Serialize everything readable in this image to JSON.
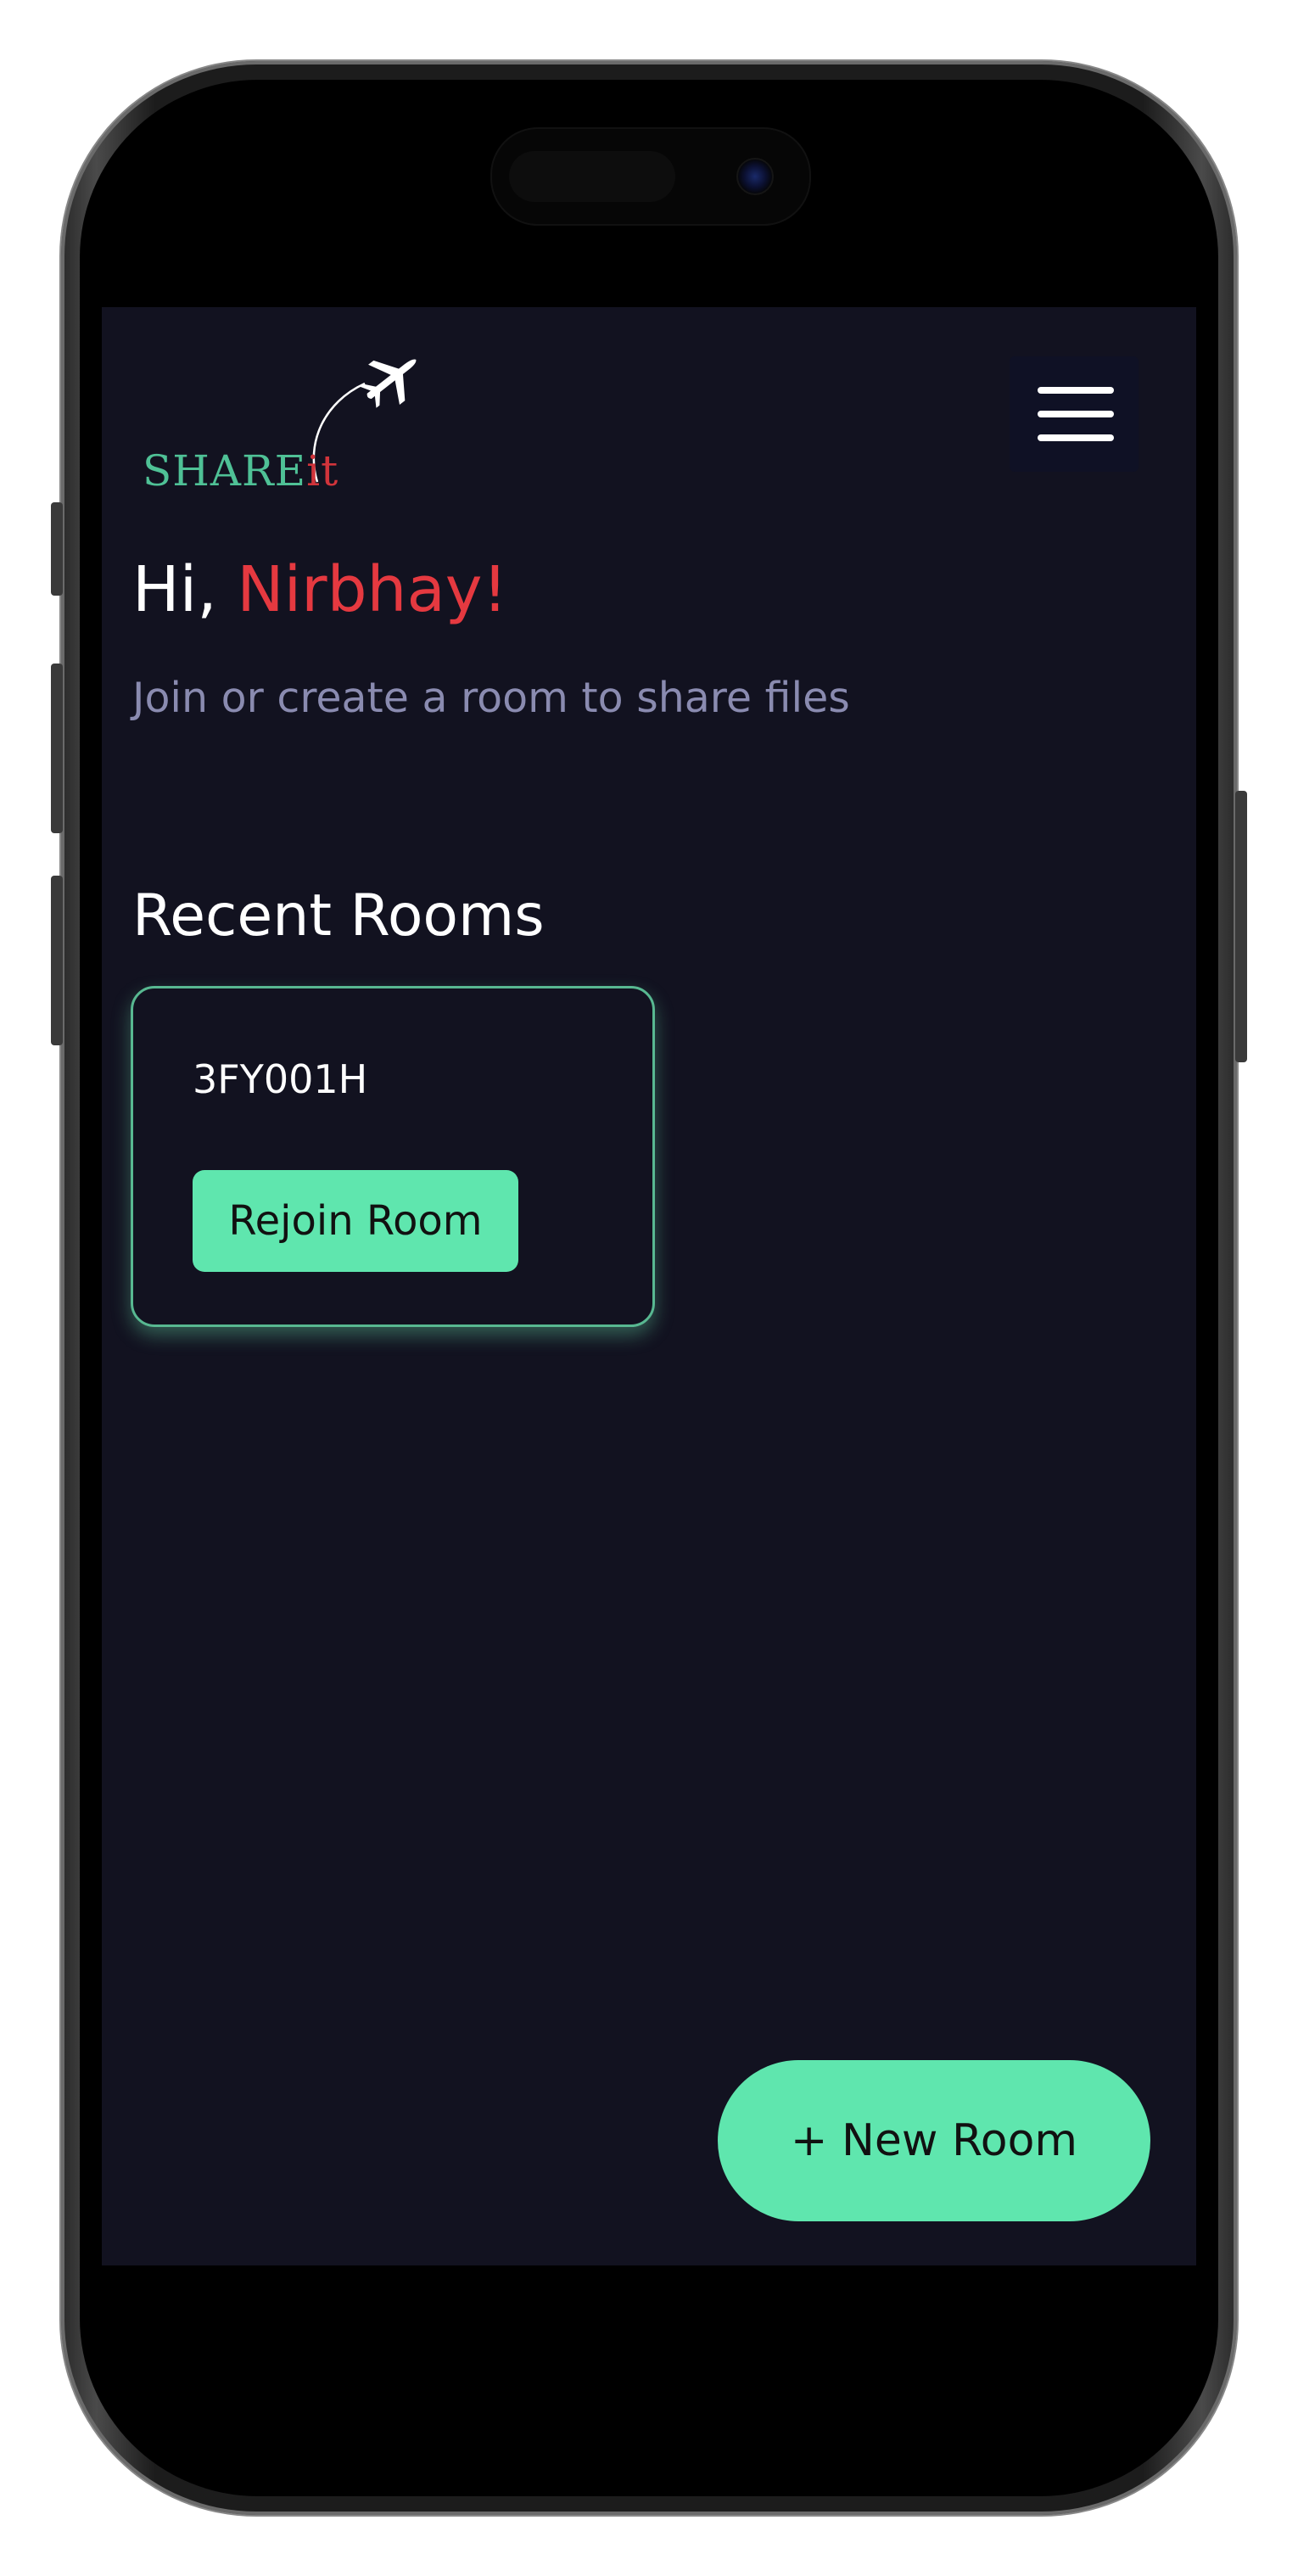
{
  "header": {
    "logo_text_main": "SHARE",
    "logo_text_accent": "it"
  },
  "greeting": {
    "prefix": "Hi, ",
    "name": "Nirbhay!",
    "subtitle": "Join or create a room to share files"
  },
  "recent_rooms": {
    "title": "Recent Rooms",
    "rooms": [
      {
        "code": "3FY001H",
        "action_label": "Rejoin Room"
      }
    ]
  },
  "fab": {
    "label": "+ New Room"
  },
  "icons": {
    "menu": "hamburger-menu-icon",
    "logo": "airplane-icon"
  },
  "colors": {
    "background": "#121220",
    "accent_green": "#5fe6ae",
    "accent_red": "#e53940",
    "muted_text": "#8a8bb0"
  }
}
